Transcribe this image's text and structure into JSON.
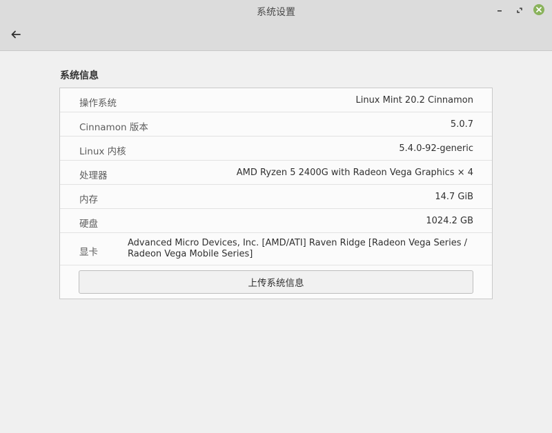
{
  "window": {
    "title": "系统设置",
    "minimize_icon": "minimize-icon",
    "restore_icon": "restore-icon",
    "close_icon": "close-icon",
    "close_color": "#8ab35c"
  },
  "header": {
    "back_icon": "back-arrow-icon"
  },
  "section": {
    "title": "系统信息"
  },
  "info_rows": [
    {
      "label": "操作系统",
      "value": "Linux Mint 20.2 Cinnamon"
    },
    {
      "label": "Cinnamon 版本",
      "value": "5.0.7"
    },
    {
      "label": "Linux 内核",
      "value": "5.4.0-92-generic"
    },
    {
      "label": "处理器",
      "value": "AMD Ryzen 5 2400G with Radeon Vega Graphics × 4"
    },
    {
      "label": "内存",
      "value": "14.7 GiB"
    },
    {
      "label": "硬盘",
      "value": "1024.2 GB"
    },
    {
      "label": "显卡",
      "value": "Advanced Micro Devices, Inc. [AMD/ATI] Raven Ridge [Radeon Vega Series / Radeon Vega Mobile Series]"
    }
  ],
  "upload_button": {
    "label": "上传系统信息"
  }
}
